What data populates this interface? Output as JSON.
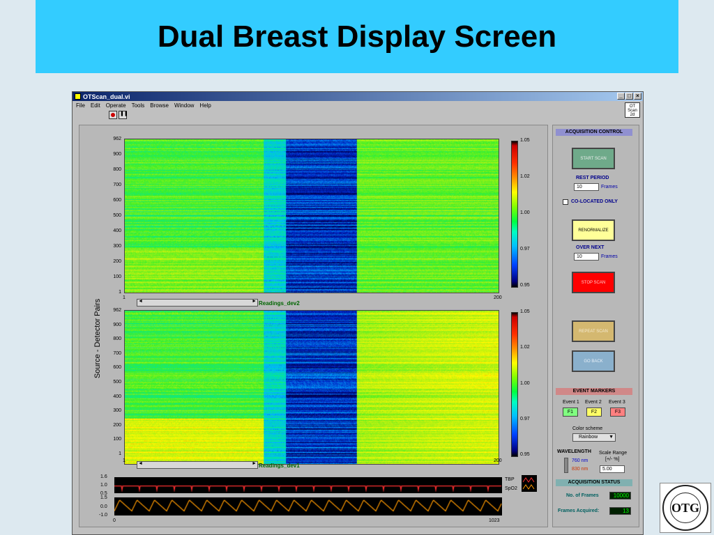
{
  "slide": {
    "title": "Dual Breast Display Screen"
  },
  "window": {
    "title": "OTScan_dual.vi",
    "menu": [
      "File",
      "Edit",
      "Operate",
      "Tools",
      "Browse",
      "Window",
      "Help"
    ],
    "ot_badge": "OT Scan 2d"
  },
  "plots": {
    "y_axis_label": "Source - Detector Pairs",
    "y_ticks": [
      "962",
      "900",
      "800",
      "700",
      "600",
      "500",
      "400",
      "300",
      "200",
      "100",
      "1"
    ],
    "x_ticks": [
      "1",
      "200"
    ],
    "colorbar_ticks": [
      "1.05",
      "1.02",
      "1.00",
      "0.97",
      "0.95"
    ],
    "top_label": "Readings_dev2",
    "bottom_label": "Readings_dev1"
  },
  "waves": {
    "top_ticks": [
      "1.6",
      "1.0",
      "0.5"
    ],
    "bottom_ticks": [
      "1.5",
      "0.0",
      "-1.0"
    ],
    "x_ticks": [
      "0",
      "1023"
    ],
    "legend": [
      "TBP",
      "SpO2"
    ],
    "colors": {
      "tbp": "#ff3030",
      "spo2": "#ff9900"
    }
  },
  "controls": {
    "acquisition_control": "ACQUISITION CONTROL",
    "start_scan": "START SCAN",
    "rest_period": "REST PERIOD",
    "rest_value": "10",
    "frames_unit": "Frames",
    "colocated": "CO-LOCATED ONLY",
    "renormalize": "RENORMALIZE",
    "over_next": "OVER NEXT",
    "over_value": "10",
    "stop_scan": "STOP SCAN",
    "repeat_scan": "REPEAT SCAN",
    "go_back": "GO BACK",
    "event_markers": "EVENT MARKERS",
    "events": [
      {
        "label": "Event 1",
        "key": "F1",
        "color": "#80ff80"
      },
      {
        "label": "Event 2",
        "key": "F2",
        "color": "#ffff66"
      },
      {
        "label": "Event 3",
        "key": "F3",
        "color": "#ff8080"
      }
    ],
    "color_scheme_label": "Color scheme",
    "color_scheme_value": "Rainbow",
    "wavelength": "WAVELENGTH",
    "wl_760": "760 nm",
    "wl_830": "830 nm",
    "scale_range": "Scale Range",
    "scale_unit": "[+/- %]",
    "scale_value": "5.00",
    "acquisition_status": "ACQUISITION STATUS",
    "num_frames_label": "No. of Frames",
    "num_frames_value": "10000",
    "frames_acquired_label": "Frames Acquired:",
    "frames_acquired_value": "13"
  },
  "logo": {
    "text": "OTG"
  }
}
